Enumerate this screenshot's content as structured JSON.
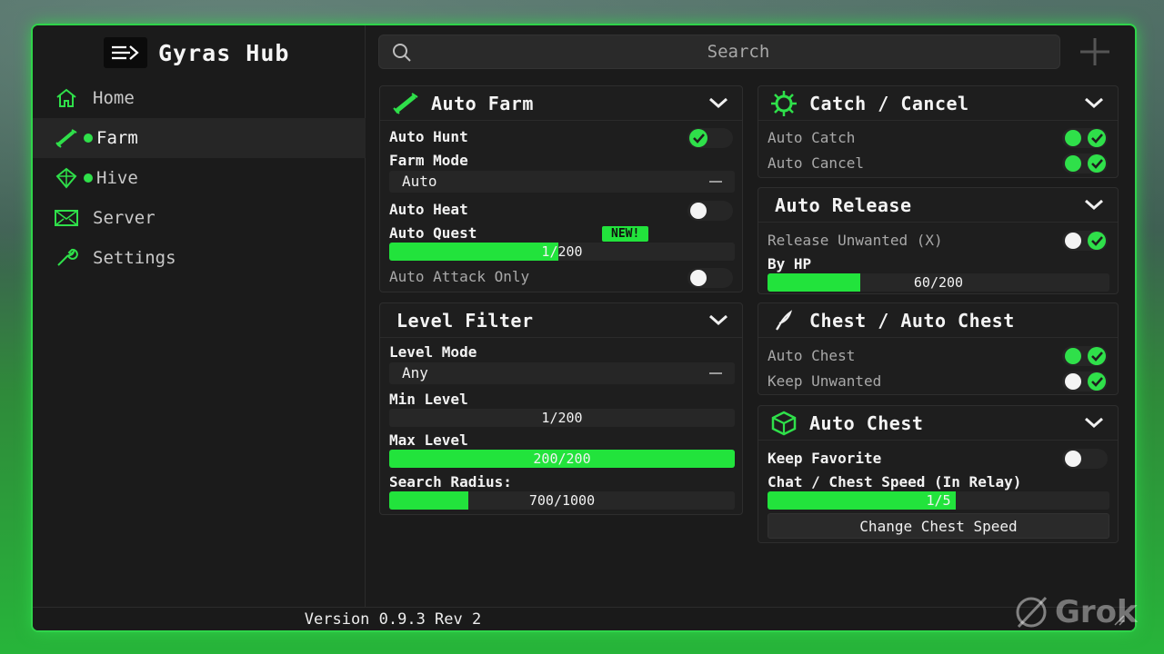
{
  "app": {
    "title": "Gyras Hub"
  },
  "sidebar": {
    "items": [
      {
        "label": "Home",
        "icon": "home-icon",
        "active": false,
        "dot": false
      },
      {
        "label": "Farm",
        "icon": "sword-icon",
        "active": true,
        "dot": true
      },
      {
        "label": "Hive",
        "icon": "gem-icon",
        "active": false,
        "dot": true
      },
      {
        "label": "Server",
        "icon": "server-icon",
        "active": false,
        "dot": false
      },
      {
        "label": "Settings",
        "icon": "wrench-icon",
        "active": false,
        "dot": false
      }
    ]
  },
  "search": {
    "placeholder": "Search"
  },
  "auto_farm": {
    "title": "Auto Farm",
    "auto_hunt": {
      "label": "Auto Hunt",
      "on": true
    },
    "farm_mode": {
      "label": "Farm Mode",
      "value": "Auto"
    },
    "auto_heat": {
      "label": "Auto Heat",
      "on": false
    },
    "auto_quest": {
      "label": "Auto Quest",
      "badge": "NEW!",
      "value_text": "1/200",
      "fraction": 0.49
    },
    "auto_attack_only": {
      "label": "Auto Attack Only",
      "on": false
    }
  },
  "level_filter": {
    "title": "Level Filter",
    "level_mode": {
      "label": "Level Mode",
      "value": "Any"
    },
    "min_level": {
      "label": "Min Level",
      "value_text": "1/200",
      "fraction": 0.0
    },
    "max_level": {
      "label": "Max Level",
      "value_text": "200/200",
      "fraction": 1.0
    },
    "search_radius": {
      "label": "Search Radius:",
      "value_text": "700/1000",
      "fraction": 0.23
    }
  },
  "catch_cancel": {
    "title": "Catch / Cancel",
    "auto_catch": {
      "label": "Auto Catch",
      "on": true
    },
    "auto_cancel": {
      "label": "Auto Cancel",
      "on": true
    }
  },
  "auto_release": {
    "title": "Auto Release",
    "release_unwanted": {
      "label": "Release Unwanted (X)",
      "on": false
    },
    "by_hp": {
      "label": "By HP",
      "value_text": "60/200",
      "fraction": 0.27
    }
  },
  "chest_auto_chest": {
    "title": "Chest / Auto Chest",
    "auto_chest": {
      "label": "Auto Chest",
      "on": true
    },
    "keep_unwanted": {
      "label": "Keep Unwanted",
      "on": false
    }
  },
  "auto_chest": {
    "title": "Auto Chest",
    "keep_favorite": {
      "label": "Keep Favorite",
      "on": false
    },
    "chest_speed": {
      "label": "Chat / Chest Speed (In Relay)",
      "value_text": "1/5",
      "fraction": 0.55
    },
    "change_button": "Change Chest Speed"
  },
  "footer": {
    "version": "Version 0.9.3 Rev 2"
  },
  "watermark": "Grok",
  "colors": {
    "accent": "#22e33c",
    "panel": "#1e1e1e",
    "window": "#1b1b1b"
  }
}
